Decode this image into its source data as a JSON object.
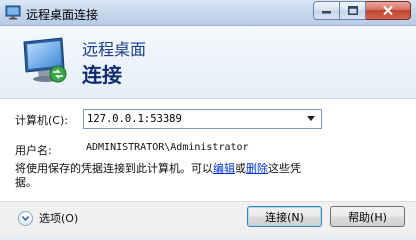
{
  "window": {
    "title": "远程桌面连接"
  },
  "banner": {
    "subtitle": "远程桌面",
    "title": "连接"
  },
  "form": {
    "computer_label": "计算机(C):",
    "computer_value": "127.0.0.1:53389",
    "username_label": "用户名:",
    "username_value": "ADMINISTRATOR\\Administrator",
    "note_before": "将使用保存的凭据连接到此计算机。可以",
    "edit_link": "编辑",
    "or_text": "或",
    "delete_link": "删除",
    "note_after": "这些凭据。"
  },
  "footer": {
    "options_label": "选项(O)",
    "connect_label": "连接(N)",
    "help_label": "帮助(H)"
  },
  "colors": {
    "banner_title": "#0f2c6e",
    "link": "#0033cc",
    "close_button": "#c1412c"
  },
  "icons": {
    "app": "remote-desktop-icon",
    "banner": "monitor-icon",
    "options": "chevron-down-icon"
  }
}
